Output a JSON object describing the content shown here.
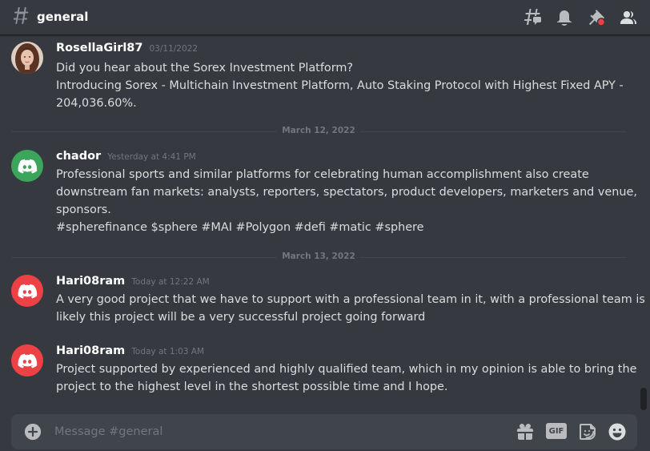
{
  "header": {
    "channel_name": "general",
    "icons": [
      "threads-icon",
      "bell-icon",
      "pin-icon",
      "members-icon"
    ]
  },
  "messages": [
    {
      "username": "RosellaGirl87",
      "timestamp": "03/11/2022",
      "avatar": "photo",
      "lines": [
        "Did you hear about the Sorex Investment Platform?",
        "Introducing Sorex - Multichain Investment Platform, Auto Staking Protocol with Highest Fixed APY -",
        "204,036.60%."
      ]
    },
    {
      "username": "chador",
      "timestamp": "Yesterday at 4:41 PM",
      "avatar": "discord-green",
      "lines": [
        "Professional sports and similar platforms for celebrating human accomplishment also create",
        "downstream fan markets: analysts, reporters, spectators, product developers, marketers and venue,",
        "sponsors.",
        "#spherefinance $sphere #MAI #Polygon #defi #matic #sphere"
      ]
    },
    {
      "username": "Hari08ram",
      "timestamp": "Today at 12:22 AM",
      "avatar": "discord-red",
      "lines": [
        "A very good project that we have to support with a professional team in it, with a professional team is",
        "likely this project will be a very successful project going forward"
      ]
    },
    {
      "username": "Hari08ram",
      "timestamp": "Today at 1:03 AM",
      "avatar": "discord-red",
      "lines": [
        "Project supported by experienced and highly qualified team, which in my opinion is able to bring the",
        "project to the highest level in the shortest possible time and I hope."
      ]
    }
  ],
  "dividers": [
    "March 12, 2022",
    "March 13, 2022"
  ],
  "composer": {
    "placeholder": "Message #general",
    "icons": [
      "add-icon",
      "gift-icon",
      "gif-icon",
      "sticker-icon",
      "emoji-icon"
    ],
    "gif_label": "GIF"
  },
  "colors": {
    "background": "#36393f",
    "composer": "#40444b",
    "discord_green": "#3ba55c",
    "discord_red": "#ed4245",
    "muted": "#72767d",
    "notification": "#ed4245"
  }
}
